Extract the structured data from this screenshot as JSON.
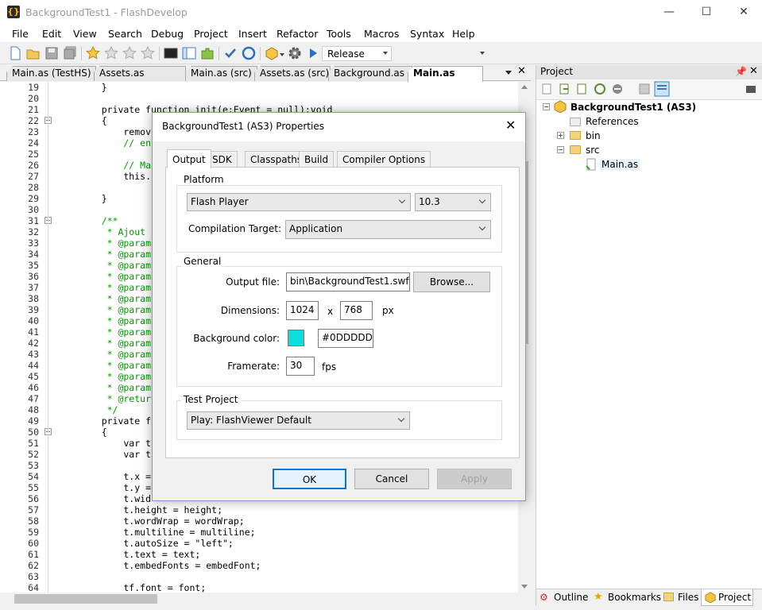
{
  "window": {
    "title": "BackgroundTest1 - FlashDevelop",
    "minimize": "—",
    "maximize": "☐",
    "close": "✕"
  },
  "menu": [
    "File",
    "Edit",
    "View",
    "Search",
    "Debug",
    "Project",
    "Insert",
    "Refactor",
    "Tools",
    "Macros",
    "Syntax",
    "Help"
  ],
  "toolbar": {
    "configuration": "Release"
  },
  "tabs": [
    "Main.as (TestHS)",
    "Assets.as (TestHS)",
    "Main.as (src)",
    "Assets.as (src)",
    "Background.as",
    "Main.as (src)"
  ],
  "editor": {
    "lines": [
      {
        "n": "19",
        "code": "    }"
      },
      {
        "n": "20",
        "code": ""
      },
      {
        "n": "21",
        "code": "    private function init(e:Event = null):void"
      },
      {
        "n": "22",
        "code": "    {"
      },
      {
        "n": "23",
        "code": "        remov"
      },
      {
        "n": "24",
        "code": "        // en"
      },
      {
        "n": "25",
        "code": ""
      },
      {
        "n": "26",
        "code": "        // Ma"
      },
      {
        "n": "27",
        "code": "        this."
      },
      {
        "n": "28",
        "code": ""
      },
      {
        "n": "29",
        "code": "    }"
      },
      {
        "n": "30",
        "code": ""
      },
      {
        "n": "31",
        "code": "    /**"
      },
      {
        "n": "32",
        "code": "     * Ajout"
      },
      {
        "n": "33",
        "code": "     * @param"
      },
      {
        "n": "34",
        "code": "     * @param"
      },
      {
        "n": "35",
        "code": "     * @param"
      },
      {
        "n": "36",
        "code": "     * @param"
      },
      {
        "n": "37",
        "code": "     * @param"
      },
      {
        "n": "38",
        "code": "     * @param"
      },
      {
        "n": "39",
        "code": "     * @param"
      },
      {
        "n": "40",
        "code": "     * @param"
      },
      {
        "n": "41",
        "code": "     * @param"
      },
      {
        "n": "42",
        "code": "     * @param"
      },
      {
        "n": "43",
        "code": "     * @param"
      },
      {
        "n": "44",
        "code": "     * @param"
      },
      {
        "n": "45",
        "code": "     * @param"
      },
      {
        "n": "46",
        "code": "     * @param"
      },
      {
        "n": "47",
        "code": "     * @retur"
      },
      {
        "n": "48",
        "code": "     */"
      },
      {
        "n": "49",
        "code": "    private f"
      },
      {
        "n": "50",
        "code": "    {"
      },
      {
        "n": "51",
        "code": "        var t"
      },
      {
        "n": "52",
        "code": "        var t"
      },
      {
        "n": "53",
        "code": ""
      },
      {
        "n": "54",
        "code": "        t.x ="
      },
      {
        "n": "55",
        "code": "        t.y ="
      },
      {
        "n": "56",
        "code": "        t.wid"
      },
      {
        "n": "57",
        "code": "        t.height = height;"
      },
      {
        "n": "58",
        "code": "        t.wordWrap = wordWrap;"
      },
      {
        "n": "59",
        "code": "        t.multiline = multiline;"
      },
      {
        "n": "60",
        "code": "        t.autoSize = \"left\";"
      },
      {
        "n": "61",
        "code": "        t.text = text;"
      },
      {
        "n": "62",
        "code": "        t.embedFonts = embedFont;"
      },
      {
        "n": "63",
        "code": ""
      },
      {
        "n": "64",
        "code": "        tf.font = font;"
      }
    ]
  },
  "project": {
    "title": "Project",
    "root": "BackgroundTest1 (AS3)",
    "items": [
      "References",
      "bin",
      "src",
      "Main.as"
    ],
    "bottom_tabs": [
      "Outline",
      "Bookmarks",
      "Files",
      "Project"
    ]
  },
  "dialog": {
    "title": "BackgroundTest1 (AS3) Properties",
    "tabs": [
      "Output",
      "SDK",
      "Classpaths",
      "Build",
      "Compiler Options"
    ],
    "platform_group": "Platform",
    "platform": "Flash Player",
    "version": "10.3",
    "compilation_target_label": "Compilation Target:",
    "compilation_target": "Application",
    "general_group": "General",
    "output_file_label": "Output file:",
    "output_file": "bin\\BackgroundTest1.swf",
    "browse": "Browse...",
    "dimensions_label": "Dimensions:",
    "width": "1024",
    "x": "x",
    "height": "768",
    "px": "px",
    "bgcolor_label": "Background color:",
    "bgcolor_swatch": "#0DDDDD",
    "bgcolor": "#0DDDDD",
    "framerate_label": "Framerate:",
    "framerate": "30",
    "fps": "fps",
    "test_group": "Test Project",
    "test_project": "Play: FlashViewer Default",
    "ok": "OK",
    "cancel": "Cancel",
    "apply": "Apply"
  }
}
